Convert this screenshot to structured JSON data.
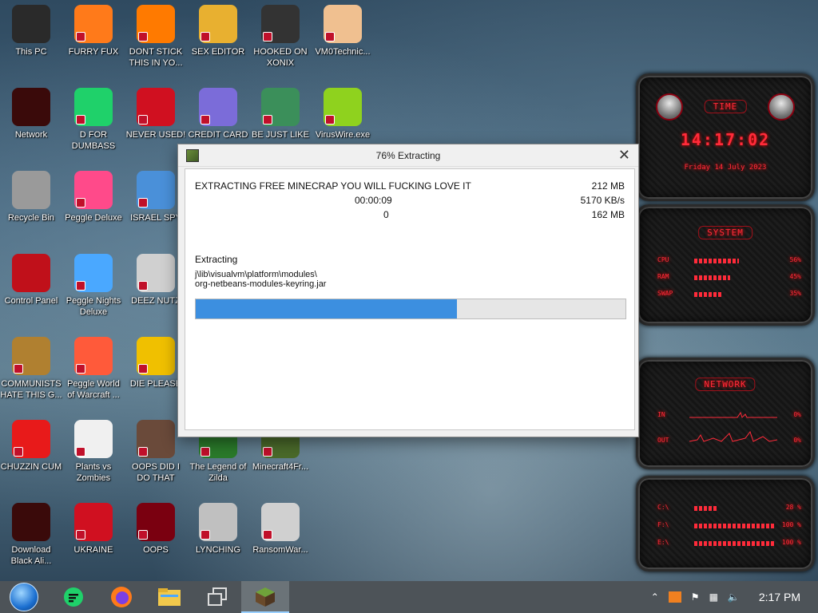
{
  "desktop": {
    "icons": [
      {
        "label": "This PC",
        "icon": "monitor-icon",
        "color": "#2a2a2a"
      },
      {
        "label": "FURRY FUX",
        "icon": "firefox-icon",
        "color": "#ff7a1a"
      },
      {
        "label": "DONT STICK THIS IN YO...",
        "icon": "traffic-cone-icon",
        "color": "#ff7a00"
      },
      {
        "label": "SEX EDITOR",
        "icon": "hex-editor-icon",
        "color": "#e8b030"
      },
      {
        "label": "HOOKED ON XONIX",
        "icon": "xonix-icon",
        "color": "#333333"
      },
      {
        "label": "VM0Technic...",
        "icon": "doctor-icon",
        "color": "#f0c090"
      },
      {
        "label": "Network",
        "icon": "alienware-icon",
        "color": "#3a0a0a"
      },
      {
        "label": "D FOR DUMBASS",
        "icon": "chat-icon",
        "color": "#1fd16a"
      },
      {
        "label": "NEVER USED!",
        "icon": "devcpp-icon",
        "color": "#d01020"
      },
      {
        "label": "CREDIT CARD",
        "icon": "credit-card-icon",
        "color": "#7b6cd9"
      },
      {
        "label": "BE JUST LIKE",
        "icon": "gnome-icon",
        "color": "#3b8f5a"
      },
      {
        "label": "VirusWire.exe",
        "icon": "lime-icon",
        "color": "#8fd21e"
      },
      {
        "label": "Recycle Bin",
        "icon": "recycle-bin-icon",
        "color": "#9a9a9a"
      },
      {
        "label": "Peggle Deluxe",
        "icon": "peggle-icon",
        "color": "#ff4a8a"
      },
      {
        "label": "ISRAEL SPY",
        "icon": "remote-desktop-icon",
        "color": "#4a90d9"
      },
      {
        "label": "Control Panel",
        "icon": "control-panel-icon",
        "color": "#c0101a"
      },
      {
        "label": "Peggle Nights Deluxe",
        "icon": "peggle-nights-icon",
        "color": "#4aa8ff"
      },
      {
        "label": "DEEZ NUTZ",
        "icon": "windows-stack-icon",
        "color": "#d0d0d0"
      },
      {
        "label": "COMMUNISTS HATE THIS G...",
        "icon": "money-bag-icon",
        "color": "#b08030"
      },
      {
        "label": "Peggle World of Warcraft ...",
        "icon": "peggle-wow-icon",
        "color": "#ff5a3a"
      },
      {
        "label": "DIE PLEASE",
        "icon": "de-icon",
        "color": "#f0c000"
      },
      {
        "label": "CHUZZIN CUM",
        "icon": "chuzzle-icon",
        "color": "#e81a1a"
      },
      {
        "label": "Plants vs Zombies",
        "icon": "flower-icon",
        "color": "#f0f0f0"
      },
      {
        "label": "OOPS DID I DO THAT",
        "icon": "portrait-icon",
        "color": "#6a4a3a"
      },
      {
        "label": "The Legend of Zilda",
        "icon": "link-icon",
        "color": "#2a7a2a"
      },
      {
        "label": "Minecraft4Fr...",
        "icon": "grass-block-icon",
        "color": "#4a6a2a"
      },
      {
        "label": "Download Black Ali...",
        "icon": "alienware-icon",
        "color": "#3a0a0a"
      },
      {
        "label": "UKRAINE",
        "icon": "radiation-icon",
        "color": "#d01020"
      },
      {
        "label": "OOPS",
        "icon": "hammer-icon",
        "color": "#7a0010"
      },
      {
        "label": "LYNCHING",
        "icon": "noose-icon",
        "color": "#c0c0c0"
      },
      {
        "label": "RansomWar...",
        "icon": "skull-icon",
        "color": "#d0d0d0"
      }
    ]
  },
  "dialog": {
    "title": "76% Extracting",
    "close_glyph": "✕",
    "archive_name": "EXTRACTING FREE MINECRAP YOU WILL FUCKING LOVE IT",
    "total_size": "212 MB",
    "elapsed": "00:00:09",
    "speed": "5170 KB/s",
    "remaining": "0",
    "processed": "162 MB",
    "status_label": "Extracting",
    "path_line1": "j\\lib\\visualvm\\platform\\modules\\",
    "path_line2": "org-netbeans-modules-keyring.jar",
    "progress": 0.76,
    "accent_color": "#3c8fe0"
  },
  "widgets": {
    "time_panel": {
      "title": "TIME",
      "clock": "14:17:02",
      "date": "Friday 14 July 2023"
    },
    "system_panel": {
      "title": "SYSTEM",
      "rows": [
        {
          "name": "CPU",
          "value": "56%",
          "fill": 0.56
        },
        {
          "name": "RAM",
          "value": "45%",
          "fill": 0.45
        },
        {
          "name": "SWAP",
          "value": "35%",
          "fill": 0.35
        }
      ]
    },
    "network_panel": {
      "title": "NETWORK",
      "rows": [
        {
          "name": "IN",
          "value": "0%"
        },
        {
          "name": "OUT",
          "value": "0%"
        }
      ]
    },
    "disk_panel": {
      "rows": [
        {
          "name": "C:\\",
          "value": "28 %",
          "fill": 0.28
        },
        {
          "name": "F:\\",
          "value": "100 %",
          "fill": 1.0
        },
        {
          "name": "E:\\",
          "value": "100 %",
          "fill": 1.0
        }
      ]
    }
  },
  "taskbar": {
    "apps": [
      {
        "name": "start-button",
        "icon": "start-orb-icon"
      },
      {
        "name": "chat-app",
        "icon": "chat-icon"
      },
      {
        "name": "firefox",
        "icon": "firefox-icon"
      },
      {
        "name": "file-explorer",
        "icon": "folder-icon"
      },
      {
        "name": "task-view",
        "icon": "windows-stack-icon"
      },
      {
        "name": "extractor",
        "icon": "grass-block-icon"
      }
    ],
    "tray": {
      "clock": "2:17 PM"
    }
  }
}
